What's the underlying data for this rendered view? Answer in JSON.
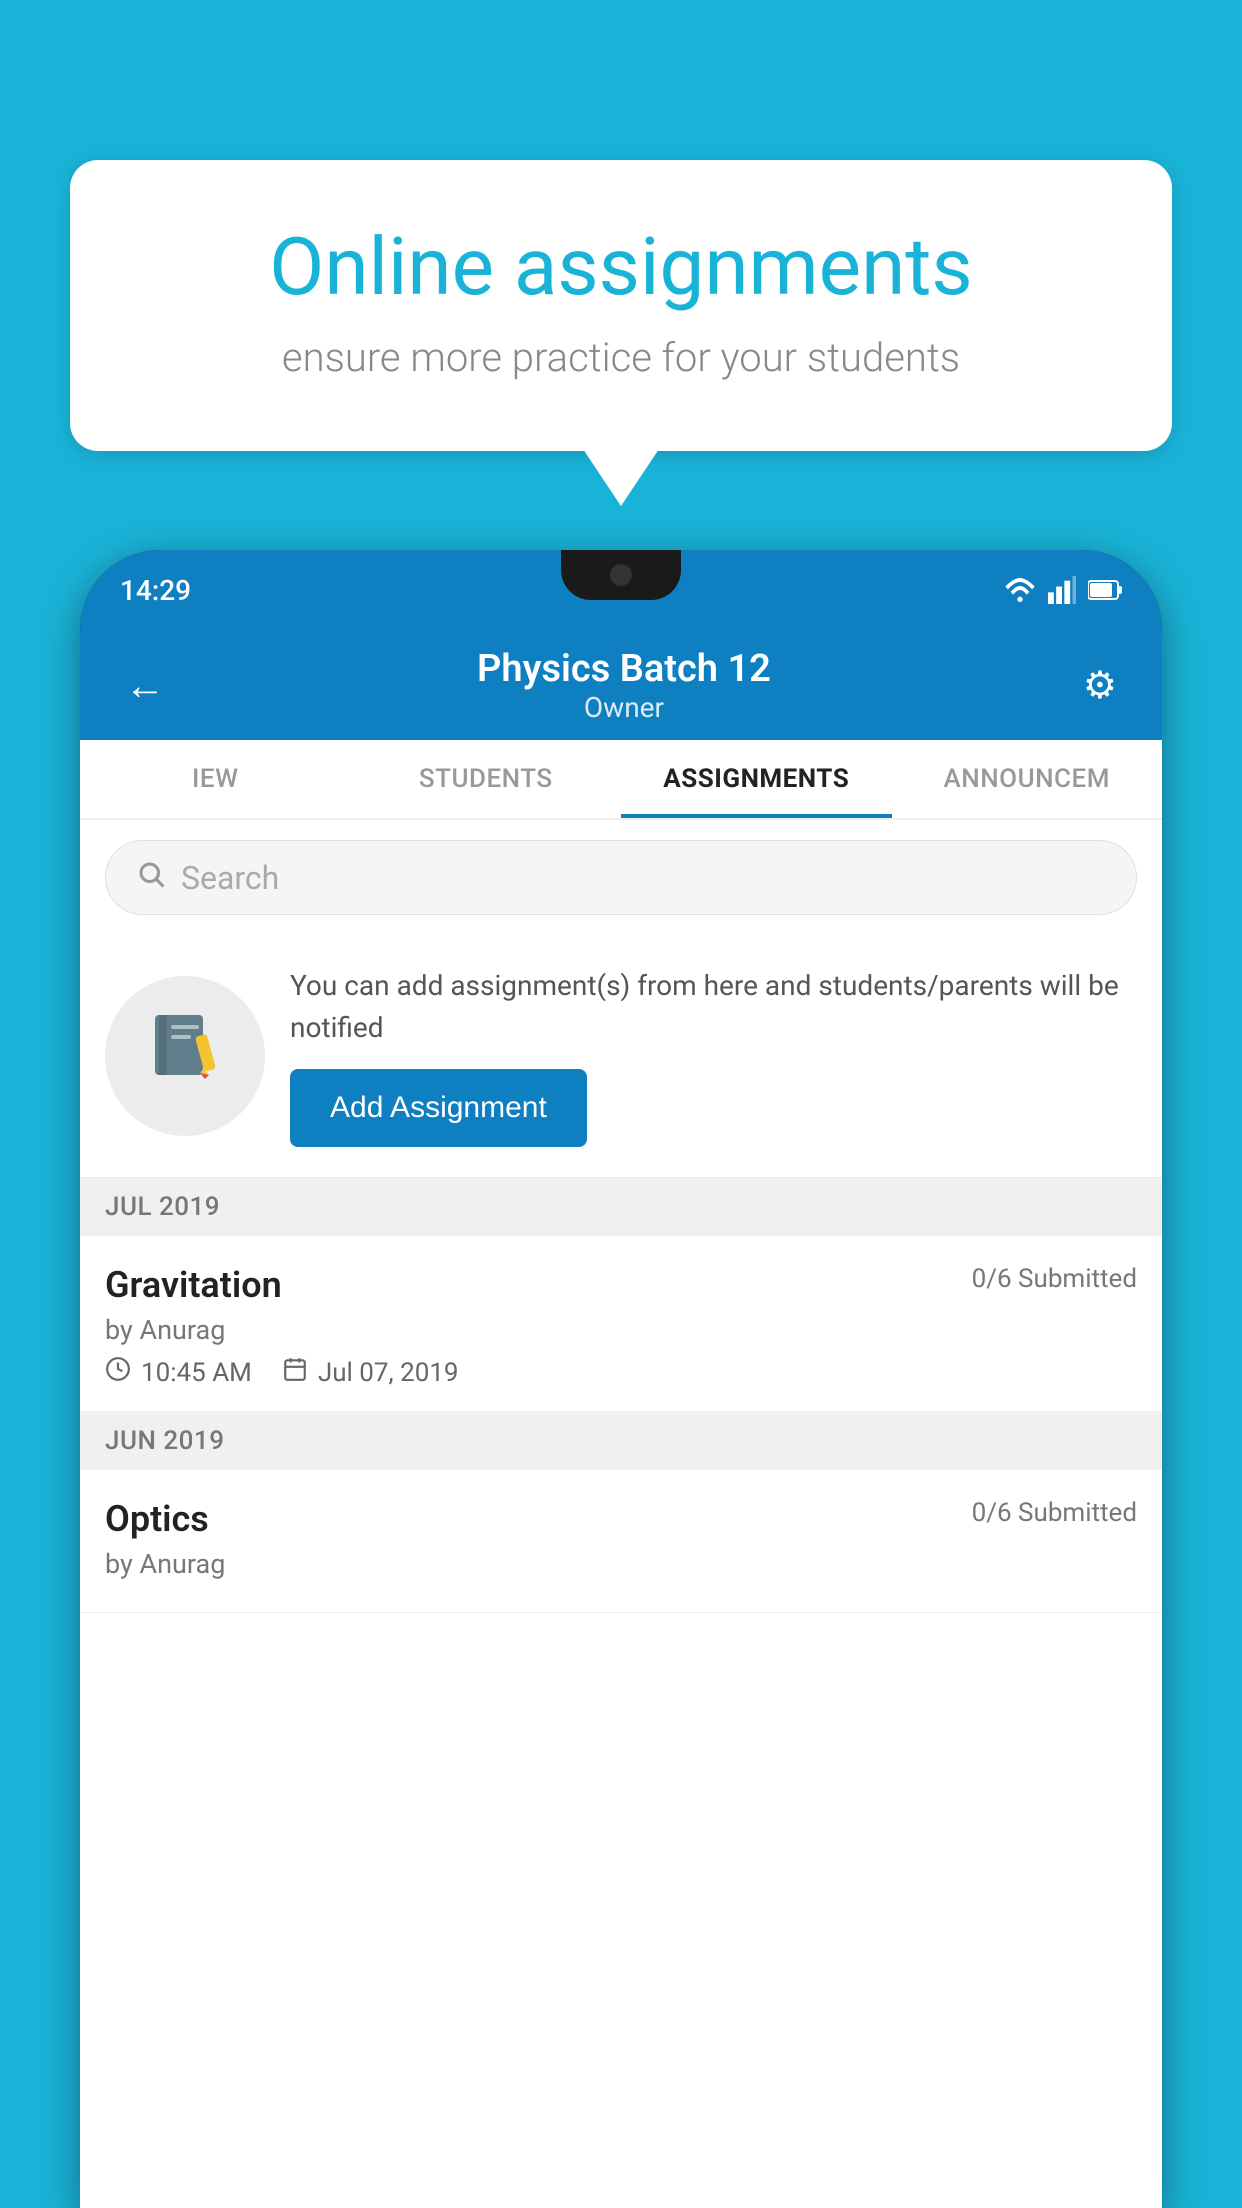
{
  "background_color": "#1ab3d8",
  "speech_bubble": {
    "title": "Online assignments",
    "subtitle": "ensure more practice for your students"
  },
  "phone": {
    "status_bar": {
      "time": "14:29",
      "icons": [
        "wifi",
        "signal",
        "battery"
      ]
    },
    "header": {
      "title": "Physics Batch 12",
      "subtitle": "Owner",
      "back_label": "←",
      "settings_label": "⚙"
    },
    "tabs": [
      {
        "label": "IEW",
        "active": false
      },
      {
        "label": "STUDENTS",
        "active": false
      },
      {
        "label": "ASSIGNMENTS",
        "active": true
      },
      {
        "label": "ANNOUNCEM",
        "active": false
      }
    ],
    "search": {
      "placeholder": "Search"
    },
    "add_assignment_section": {
      "description": "You can add assignment(s) from here and students/parents will be notified",
      "button_label": "Add Assignment"
    },
    "sections": [
      {
        "label": "JUL 2019",
        "items": [
          {
            "name": "Gravitation",
            "submitted": "0/6 Submitted",
            "by": "by Anurag",
            "time": "10:45 AM",
            "date": "Jul 07, 2019"
          }
        ]
      },
      {
        "label": "JUN 2019",
        "items": [
          {
            "name": "Optics",
            "submitted": "0/6 Submitted",
            "by": "by Anurag",
            "time": "",
            "date": ""
          }
        ]
      }
    ]
  }
}
